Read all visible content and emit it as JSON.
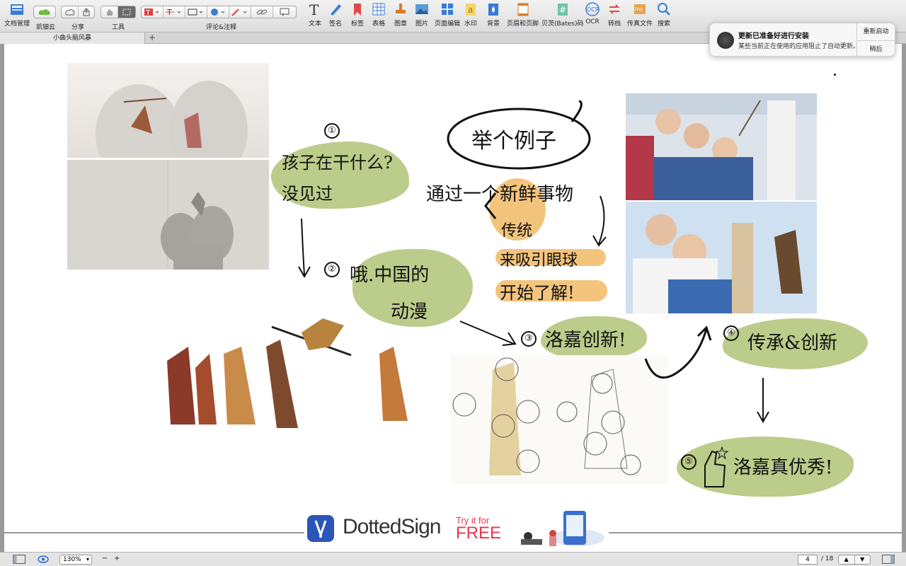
{
  "toolbar": {
    "doc_manage": "文档管理",
    "kdan_cloud": "凯钿云",
    "share": "分享",
    "tools": "工具",
    "comments": "评论&注释",
    "items": [
      {
        "label": "文本",
        "icon": "text-icon"
      },
      {
        "label": "签名",
        "icon": "pen-icon"
      },
      {
        "label": "标签",
        "icon": "bookmark-icon"
      },
      {
        "label": "表格",
        "icon": "table-icon"
      },
      {
        "label": "图章",
        "icon": "stamp-icon"
      },
      {
        "label": "图片",
        "icon": "image-icon"
      },
      {
        "label": "页面编辑",
        "icon": "grid-icon"
      },
      {
        "label": "水印",
        "icon": "watermark-icon"
      },
      {
        "label": "背景",
        "icon": "background-icon"
      },
      {
        "label": "页眉和页脚",
        "icon": "header-footer-icon"
      },
      {
        "label": "贝茨(Bates)码",
        "icon": "bates-icon"
      },
      {
        "label": "OCR",
        "icon": "ocr-icon"
      },
      {
        "label": "转档",
        "icon": "convert-icon"
      },
      {
        "label": "传真文件",
        "icon": "fax-icon"
      },
      {
        "label": "搜索",
        "icon": "search-icon"
      }
    ]
  },
  "tab": {
    "title": "小曲头脑风暴",
    "add": "+"
  },
  "notification": {
    "title": "更新已准备好进行安装",
    "body": "某些当前正在使用的应用阻止了自动更新。",
    "restart": "重新启动",
    "later": "稍后"
  },
  "page": {
    "step1_num": "①",
    "step1_text_a": "孩子在干什么?",
    "step1_text_b": "没见过",
    "title": "举个例子",
    "subtitle": "通过一个新鲜事物",
    "tradition": "传统",
    "attract": "来吸引眼球",
    "start": "开始了解!",
    "step2_text_a": "哦.中国的",
    "step2_text_b": "动漫",
    "step3_text": "洛嘉创新!",
    "step4_text": "传承&创新",
    "step5_text": "洛嘉真优秀!",
    "nums": [
      "②",
      "③",
      "④",
      "⑤"
    ]
  },
  "ad": {
    "brand": "DottedSign",
    "try": "Try it for",
    "free": "FREE"
  },
  "statusbar": {
    "zoom": "130%",
    "minus": "−",
    "plus": "+",
    "page_current": "4",
    "page_total": "/ 18"
  },
  "colors": {
    "accent_green": "#b8c984",
    "accent_orange": "#f3c47c",
    "brand_blue": "#2a56b8",
    "free_red": "#e8384f"
  }
}
